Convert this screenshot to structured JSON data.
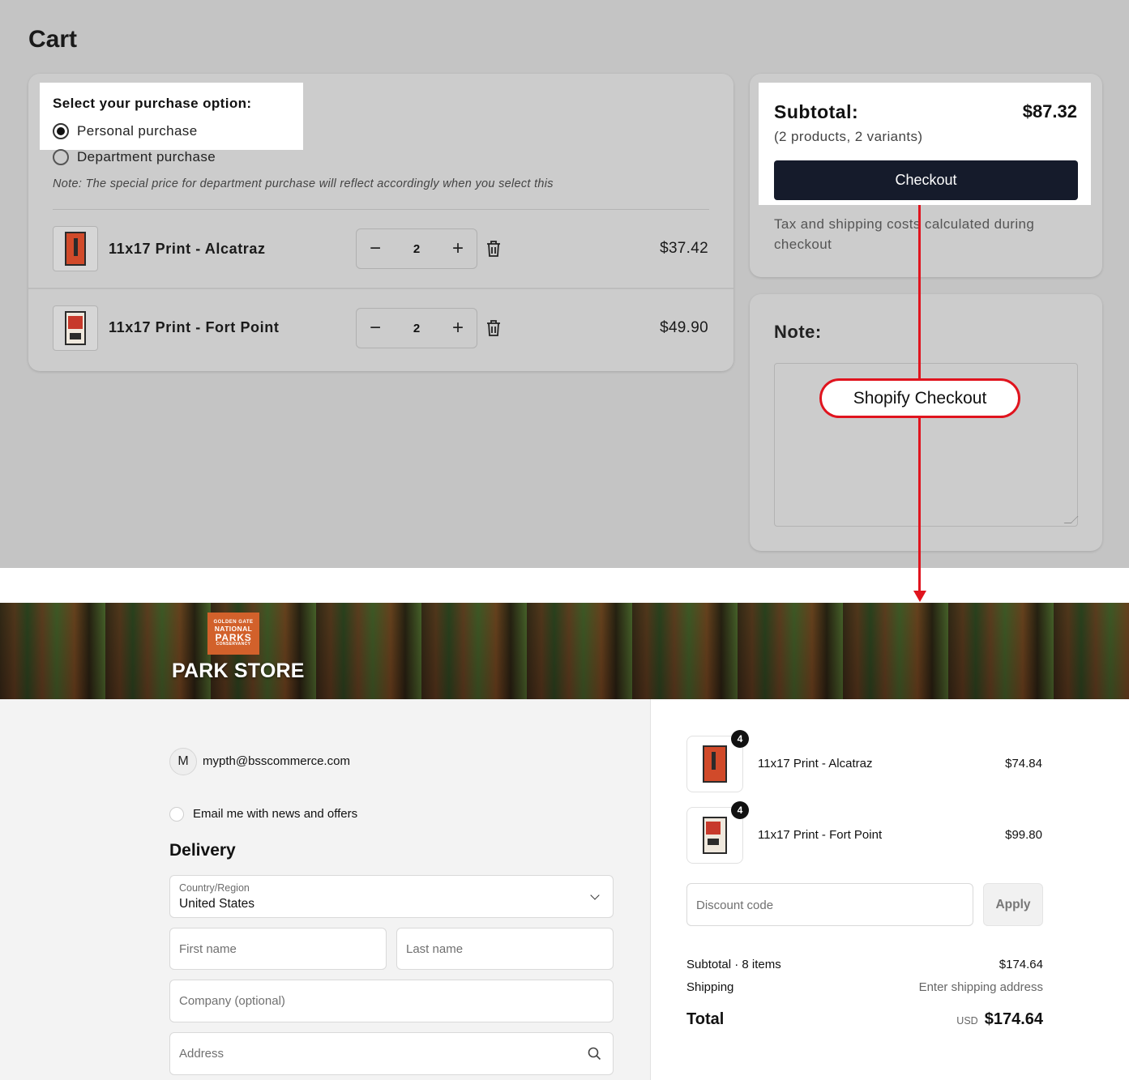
{
  "cart": {
    "title": "Cart",
    "purchase_option": {
      "title": "Select your purchase option:",
      "options": [
        {
          "label": "Personal purchase",
          "selected": true
        },
        {
          "label": "Department purchase",
          "selected": false
        }
      ],
      "note": "Note: The special price for department purchase will reflect accordingly when you select this"
    },
    "items": [
      {
        "name": "11x17 Print - Alcatraz",
        "qty": "2",
        "price": "$37.42",
        "icon": "alcatraz-print"
      },
      {
        "name": "11x17 Print - Fort Point",
        "qty": "2",
        "price": "$49.90",
        "icon": "fort-point-print"
      }
    ],
    "qty_controls": {
      "minus": "−",
      "plus": "+"
    },
    "summary": {
      "subtotal_label": "Subtotal:",
      "subtotal_value": "$87.32",
      "subtotal_note": "(2 products, 2 variants)",
      "checkout_label": "Checkout",
      "tax_note": "Tax and shipping costs calculated during checkout"
    },
    "note": {
      "label": "Note:",
      "value": ""
    }
  },
  "annotation": {
    "label": "Shopify Checkout",
    "color": "#e0141e"
  },
  "checkout": {
    "brand": {
      "badge_lines": [
        "GOLDEN GATE",
        "NATIONAL",
        "PARKS",
        "CONSERVANCY"
      ],
      "store_name": "PARK STORE",
      "badge_color": "#d2612b"
    },
    "contact": {
      "avatar_letter": "M",
      "email": "mypth@bsscommerce.com"
    },
    "newsletter_label": "Email me with news and offers",
    "delivery": {
      "heading": "Delivery",
      "country_label": "Country/Region",
      "country_value": "United States",
      "first_name_placeholder": "First name",
      "last_name_placeholder": "Last name",
      "company_placeholder": "Company (optional)",
      "address_placeholder": "Address"
    },
    "order": {
      "items": [
        {
          "name": "11x17 Print - Alcatraz",
          "qty": "4",
          "price": "$74.84"
        },
        {
          "name": "11x17 Print - Fort Point",
          "qty": "4",
          "price": "$99.80"
        }
      ],
      "discount_placeholder": "Discount code",
      "apply_label": "Apply",
      "subtotal_label": "Subtotal · 8 items",
      "subtotal_value": "$174.64",
      "shipping_label": "Shipping",
      "shipping_value": "Enter shipping address",
      "total_label": "Total",
      "currency": "USD",
      "total_value": "$174.64"
    }
  }
}
